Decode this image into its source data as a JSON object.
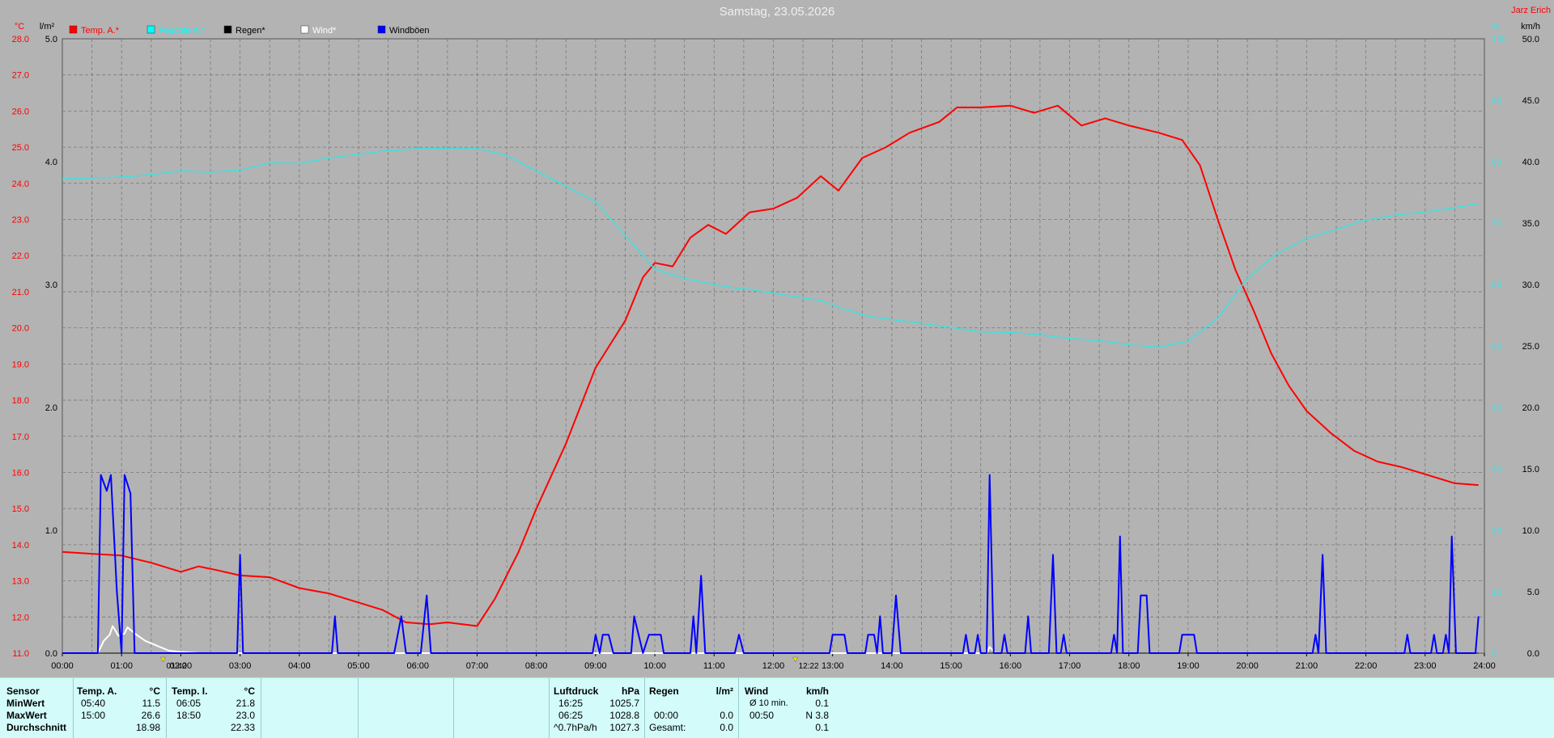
{
  "title": "Samstag, 23.05.2026",
  "corner_label": "Jarz Erich",
  "left_units": [
    "°C",
    "l/m²"
  ],
  "right_units": [
    "%",
    "km/h"
  ],
  "legend": [
    {
      "label": "Temp. A.*",
      "swatch": "#ff0000",
      "text_color": "#ff0000"
    },
    {
      "label": "Feuchte A.*",
      "swatch": "#00ffff",
      "text_color": "#00ffff"
    },
    {
      "label": "Regen*",
      "swatch": "#000000",
      "text_color": "#000000"
    },
    {
      "label": "Wind*",
      "swatch": "#ffffff",
      "text_color": "#ffffff"
    },
    {
      "label": "Windböen",
      "swatch": "#0000ff",
      "text_color": "#000000"
    }
  ],
  "markers": [
    {
      "time": "01:42",
      "x_hours": 1.7
    },
    {
      "time": "12:22",
      "x_hours": 12.37
    }
  ],
  "colors": {
    "temperature": "#ff0000",
    "humidity": "#40e0e0",
    "rain": "#000000",
    "wind": "#ffffff",
    "gusts": "#0000ff",
    "background": "#b3b3b3",
    "panel": "#d2fbfa"
  },
  "chart_data": {
    "type": "line",
    "x_axis": {
      "label_format": "HH:MM",
      "range_hours": [
        0,
        24
      ],
      "tick_labels": [
        "00:00",
        "01:00",
        "02:00",
        "03:00",
        "04:00",
        "05:00",
        "06:00",
        "07:00",
        "08:00",
        "09:00",
        "10:00",
        "11:00",
        "12:00",
        "13:00",
        "14:00",
        "15:00",
        "16:00",
        "17:00",
        "18:00",
        "19:00",
        "20:00",
        "21:00",
        "22:00",
        "23:00",
        "24:00"
      ]
    },
    "y_temp": {
      "unit": "°C",
      "range": [
        11.0,
        28.0
      ],
      "tick_labels": [
        "11.0",
        "12.0",
        "13.0",
        "14.0",
        "15.0",
        "16.0",
        "17.0",
        "18.0",
        "19.0",
        "20.0",
        "21.0",
        "22.0",
        "23.0",
        "24.0",
        "25.0",
        "26.0",
        "27.0",
        "28.0"
      ]
    },
    "y_rain": {
      "unit": "l/m²",
      "range": [
        0.0,
        5.0
      ],
      "tick_labels": [
        "0.0",
        "1.0",
        "2.0",
        "3.0",
        "4.0",
        "5.0"
      ]
    },
    "y_humidity": {
      "unit": "%",
      "range": [
        0,
        100
      ],
      "tick_labels": [
        "0",
        "10",
        "20",
        "30",
        "40",
        "50",
        "60",
        "70",
        "80",
        "90",
        "100"
      ]
    },
    "y_wind": {
      "unit": "km/h",
      "range": [
        0.0,
        50.0
      ],
      "tick_labels": [
        "0.0",
        "5.0",
        "10.0",
        "15.0",
        "20.0",
        "25.0",
        "30.0",
        "35.0",
        "40.0",
        "45.0",
        "50.0"
      ]
    },
    "grid": true,
    "series": [
      {
        "name": "Temp. A.*",
        "axis": "y_temp",
        "points": [
          [
            0,
            13.8
          ],
          [
            0.5,
            13.75
          ],
          [
            1.0,
            13.7
          ],
          [
            1.5,
            13.5
          ],
          [
            2.0,
            13.25
          ],
          [
            2.3,
            13.4
          ],
          [
            2.6,
            13.3
          ],
          [
            3.0,
            13.15
          ],
          [
            3.5,
            13.1
          ],
          [
            4.0,
            12.8
          ],
          [
            4.5,
            12.65
          ],
          [
            5.0,
            12.4
          ],
          [
            5.4,
            12.2
          ],
          [
            5.8,
            11.85
          ],
          [
            6.2,
            11.8
          ],
          [
            6.5,
            11.85
          ],
          [
            7.0,
            11.75
          ],
          [
            7.3,
            12.5
          ],
          [
            7.7,
            13.8
          ],
          [
            8.0,
            15.0
          ],
          [
            8.5,
            16.8
          ],
          [
            9.0,
            18.9
          ],
          [
            9.5,
            20.2
          ],
          [
            9.8,
            21.4
          ],
          [
            10.0,
            21.8
          ],
          [
            10.3,
            21.7
          ],
          [
            10.6,
            22.5
          ],
          [
            10.9,
            22.85
          ],
          [
            11.2,
            22.6
          ],
          [
            11.6,
            23.2
          ],
          [
            12.0,
            23.3
          ],
          [
            12.4,
            23.6
          ],
          [
            12.8,
            24.2
          ],
          [
            13.1,
            23.8
          ],
          [
            13.5,
            24.7
          ],
          [
            13.9,
            25.0
          ],
          [
            14.3,
            25.4
          ],
          [
            14.8,
            25.7
          ],
          [
            15.1,
            26.1
          ],
          [
            15.5,
            26.1
          ],
          [
            16.0,
            26.15
          ],
          [
            16.4,
            25.95
          ],
          [
            16.8,
            26.15
          ],
          [
            17.2,
            25.6
          ],
          [
            17.6,
            25.8
          ],
          [
            18.0,
            25.6
          ],
          [
            18.5,
            25.4
          ],
          [
            18.9,
            25.2
          ],
          [
            19.2,
            24.5
          ],
          [
            19.5,
            23.0
          ],
          [
            19.8,
            21.6
          ],
          [
            20.1,
            20.5
          ],
          [
            20.4,
            19.3
          ],
          [
            20.7,
            18.4
          ],
          [
            21.0,
            17.7
          ],
          [
            21.4,
            17.1
          ],
          [
            21.8,
            16.6
          ],
          [
            22.2,
            16.3
          ],
          [
            22.6,
            16.15
          ],
          [
            23.0,
            15.95
          ],
          [
            23.5,
            15.7
          ],
          [
            23.9,
            15.65
          ]
        ]
      },
      {
        "name": "Feuchte A.*",
        "axis": "y_humidity",
        "points": [
          [
            0,
            77.2
          ],
          [
            1.0,
            77.5
          ],
          [
            1.5,
            77.9
          ],
          [
            2.0,
            78.5
          ],
          [
            2.5,
            78.3
          ],
          [
            3.0,
            78.6
          ],
          [
            3.5,
            79.8
          ],
          [
            4.0,
            79.7
          ],
          [
            4.5,
            80.6
          ],
          [
            5.0,
            81.2
          ],
          [
            5.5,
            81.8
          ],
          [
            6.0,
            82.1
          ],
          [
            7.0,
            82.2
          ],
          [
            7.5,
            81.0
          ],
          [
            8.0,
            78.5
          ],
          [
            8.5,
            76.0
          ],
          [
            9.0,
            73.5
          ],
          [
            9.5,
            68.0
          ],
          [
            10.0,
            62.5
          ],
          [
            10.5,
            61.0
          ],
          [
            11.0,
            60.0
          ],
          [
            11.3,
            59.5
          ],
          [
            11.6,
            59.2
          ],
          [
            12.0,
            58.6
          ],
          [
            12.4,
            58.0
          ],
          [
            12.8,
            57.4
          ],
          [
            13.2,
            56.0
          ],
          [
            13.6,
            54.8
          ],
          [
            14.0,
            54.3
          ],
          [
            14.5,
            53.7
          ],
          [
            15.0,
            53.0
          ],
          [
            15.5,
            52.3
          ],
          [
            16.0,
            52.2
          ],
          [
            16.5,
            51.8
          ],
          [
            17.0,
            51.2
          ],
          [
            17.5,
            50.9
          ],
          [
            18.0,
            50.2
          ],
          [
            18.5,
            49.8
          ],
          [
            19.0,
            50.8
          ],
          [
            19.5,
            54.5
          ],
          [
            20.0,
            61.0
          ],
          [
            20.5,
            65.0
          ],
          [
            21.0,
            67.5
          ],
          [
            21.5,
            69.0
          ],
          [
            22.0,
            70.5
          ],
          [
            22.5,
            71.3
          ],
          [
            23.0,
            71.8
          ],
          [
            23.5,
            72.5
          ],
          [
            23.9,
            73.2
          ]
        ]
      },
      {
        "name": "Regen*",
        "axis": "y_rain",
        "points": [
          [
            0,
            0.0
          ],
          [
            23.9,
            0.0
          ]
        ]
      },
      {
        "name": "Wind*",
        "axis": "y_wind",
        "points": [
          [
            0.6,
            0.0
          ],
          [
            0.7,
            1.0
          ],
          [
            0.8,
            1.5
          ],
          [
            0.85,
            2.2
          ],
          [
            0.95,
            1.4
          ],
          [
            1.05,
            1.6
          ],
          [
            1.1,
            2.1
          ],
          [
            1.25,
            1.5
          ],
          [
            1.4,
            1.0
          ],
          [
            1.6,
            0.6
          ],
          [
            1.8,
            0.2
          ],
          [
            2.0,
            0.1
          ],
          [
            2.3,
            0.0
          ],
          [
            15.6,
            0.0
          ],
          [
            15.65,
            0.5
          ],
          [
            15.75,
            0.0
          ]
        ]
      },
      {
        "name": "Windböen",
        "axis": "y_wind",
        "points": [
          [
            0,
            0
          ],
          [
            0.6,
            0
          ],
          [
            0.65,
            14.5
          ],
          [
            0.75,
            13.2
          ],
          [
            0.82,
            14.5
          ],
          [
            0.92,
            5
          ],
          [
            1.0,
            0
          ],
          [
            1.05,
            14.5
          ],
          [
            1.15,
            13.0
          ],
          [
            1.22,
            0
          ],
          [
            2.95,
            0
          ],
          [
            3.0,
            8.0
          ],
          [
            3.05,
            0
          ],
          [
            4.55,
            0
          ],
          [
            4.6,
            3.0
          ],
          [
            4.65,
            0
          ],
          [
            5.6,
            0
          ],
          [
            5.72,
            3.0
          ],
          [
            5.8,
            0
          ],
          [
            6.05,
            0
          ],
          [
            6.15,
            4.7
          ],
          [
            6.22,
            0
          ],
          [
            8.95,
            0
          ],
          [
            9.0,
            1.5
          ],
          [
            9.07,
            0
          ],
          [
            9.12,
            1.5
          ],
          [
            9.22,
            1.5
          ],
          [
            9.3,
            0
          ],
          [
            9.6,
            0
          ],
          [
            9.65,
            3.0
          ],
          [
            9.8,
            0
          ],
          [
            9.9,
            1.5
          ],
          [
            10.1,
            1.5
          ],
          [
            10.15,
            0
          ],
          [
            10.6,
            0
          ],
          [
            10.65,
            3.0
          ],
          [
            10.7,
            0
          ],
          [
            10.78,
            6.3
          ],
          [
            10.85,
            0
          ],
          [
            11.35,
            0
          ],
          [
            11.42,
            1.5
          ],
          [
            11.5,
            0
          ],
          [
            12.95,
            0
          ],
          [
            13.0,
            1.5
          ],
          [
            13.2,
            1.5
          ],
          [
            13.25,
            0
          ],
          [
            13.55,
            0
          ],
          [
            13.6,
            1.5
          ],
          [
            13.7,
            1.5
          ],
          [
            13.75,
            0
          ],
          [
            13.8,
            3.0
          ],
          [
            13.85,
            0
          ],
          [
            14.0,
            0
          ],
          [
            14.07,
            4.7
          ],
          [
            14.15,
            0
          ],
          [
            15.2,
            0
          ],
          [
            15.25,
            1.5
          ],
          [
            15.3,
            0
          ],
          [
            15.4,
            0
          ],
          [
            15.45,
            1.5
          ],
          [
            15.5,
            0
          ],
          [
            15.6,
            0
          ],
          [
            15.65,
            14.5
          ],
          [
            15.72,
            0
          ],
          [
            15.85,
            0
          ],
          [
            15.9,
            1.5
          ],
          [
            15.95,
            0
          ],
          [
            16.25,
            0
          ],
          [
            16.3,
            3.0
          ],
          [
            16.35,
            0
          ],
          [
            16.65,
            0
          ],
          [
            16.72,
            8.0
          ],
          [
            16.78,
            0
          ],
          [
            16.85,
            0
          ],
          [
            16.9,
            1.5
          ],
          [
            16.95,
            0
          ],
          [
            17.7,
            0
          ],
          [
            17.75,
            1.5
          ],
          [
            17.8,
            0
          ],
          [
            17.85,
            9.5
          ],
          [
            17.9,
            0
          ],
          [
            18.15,
            0
          ],
          [
            18.2,
            4.7
          ],
          [
            18.3,
            4.7
          ],
          [
            18.35,
            0
          ],
          [
            18.85,
            0
          ],
          [
            18.9,
            1.5
          ],
          [
            19.1,
            1.5
          ],
          [
            19.15,
            0
          ],
          [
            21.1,
            0
          ],
          [
            21.15,
            1.5
          ],
          [
            21.2,
            0
          ],
          [
            21.27,
            8.0
          ],
          [
            21.33,
            0
          ],
          [
            22.65,
            0
          ],
          [
            22.7,
            1.5
          ],
          [
            22.75,
            0
          ],
          [
            23.1,
            0
          ],
          [
            23.15,
            1.5
          ],
          [
            23.2,
            0
          ],
          [
            23.3,
            0
          ],
          [
            23.35,
            1.5
          ],
          [
            23.4,
            0
          ],
          [
            23.45,
            9.5
          ],
          [
            23.52,
            0
          ],
          [
            23.85,
            0
          ],
          [
            23.9,
            3.0
          ]
        ]
      }
    ]
  },
  "summary": {
    "col1": {
      "header": "Sensor",
      "rows": [
        "MinWert",
        "MaxWert",
        "Durchschnitt"
      ]
    },
    "temp_a": {
      "header": "Temp. A.",
      "unit": "°C",
      "times": [
        "05:40",
        "15:00",
        ""
      ],
      "values": [
        "11.5",
        "26.6",
        "18.98"
      ]
    },
    "temp_i": {
      "header": "Temp. I.",
      "unit": "°C",
      "times": [
        "06:05",
        "18:50",
        ""
      ],
      "values": [
        "21.8",
        "23.0",
        "22.33"
      ]
    },
    "pressure": {
      "header": "Luftdruck",
      "unit": "hPa",
      "times": [
        "16:25",
        "06:25",
        "^0.7hPa/h"
      ],
      "values": [
        "1025.7",
        "1028.8",
        "1027.3"
      ]
    },
    "rain": {
      "header": "Regen",
      "unit": "l/m²",
      "times": [
        "",
        "00:00",
        "Gesamt:"
      ],
      "values": [
        "",
        "0.0",
        "0.0"
      ]
    },
    "wind": {
      "header": "Wind",
      "unit": "km/h",
      "times": [
        "Ø 10 min.",
        "00:50",
        ""
      ],
      "values": [
        "0.1",
        "N 3.8",
        "0.1"
      ]
    }
  }
}
